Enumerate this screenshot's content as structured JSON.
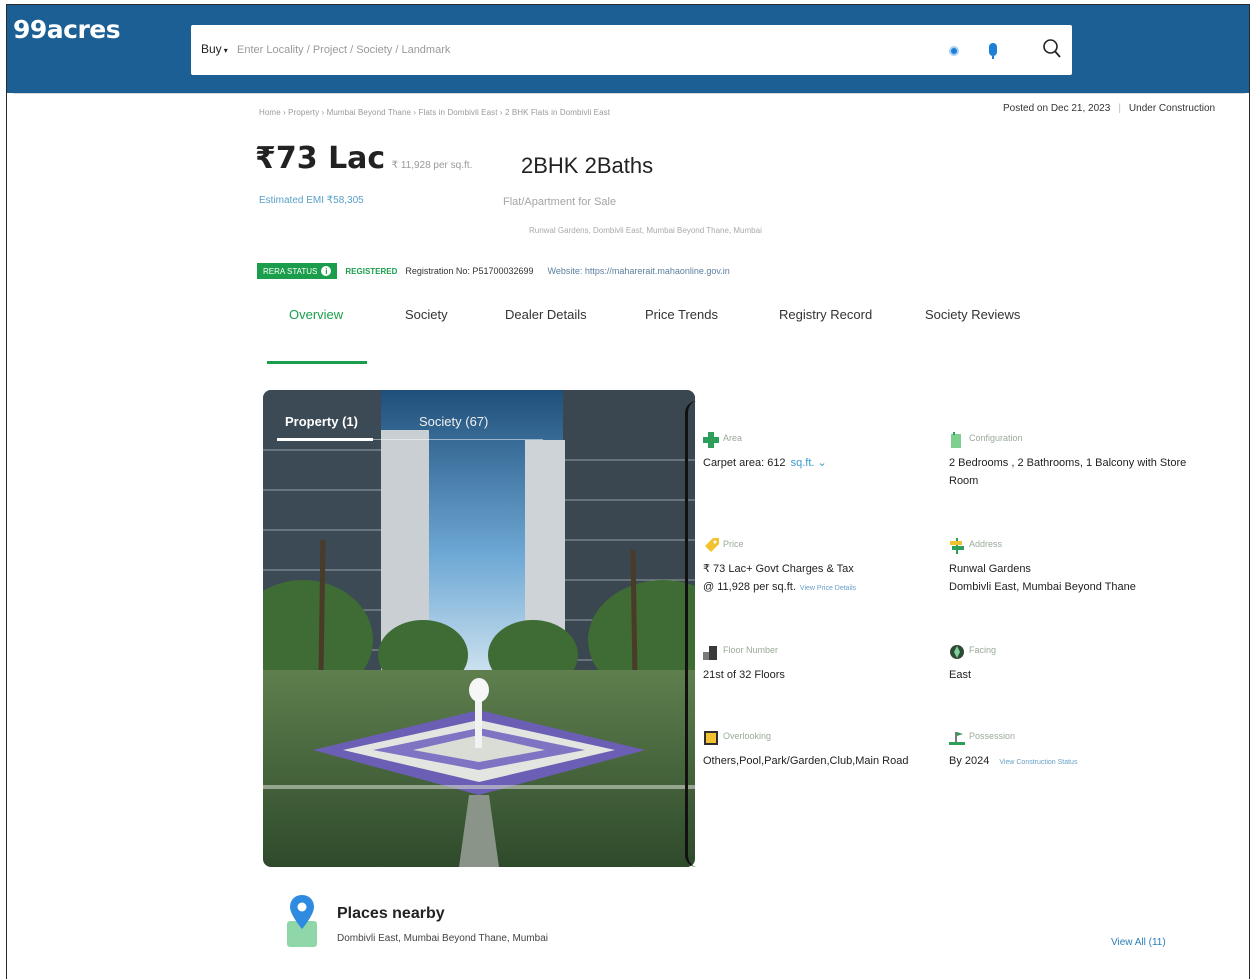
{
  "header": {
    "logo": "99acres",
    "buy_label": "Buy",
    "search_placeholder": "Enter Locality / Project / Society / Landmark"
  },
  "breadcrumb": "Home › Property › Mumbai Beyond Thane › Flats in Dombivli East › 2 BHK Flats in Dombivli East",
  "meta": {
    "posted": "Posted on Dec 21, 2023",
    "status": "Under Construction"
  },
  "listing": {
    "price": "₹73 Lac",
    "rate": "₹ 11,928 per sq.ft.",
    "emi": "Estimated EMI ₹58,305",
    "title": "2BHK 2Baths",
    "subtitle": "Flat/Apartment for Sale",
    "location": "Runwal Gardens, Dombivli East, Mumbai Beyond Thane, Mumbai"
  },
  "rera": {
    "badge": "RERA STATUS",
    "status": "REGISTERED",
    "registration": "Registration No: P51700032699",
    "website": "Website: https://maharerait.mahaonline.gov.in"
  },
  "tabs": [
    "Overview",
    "Society",
    "Dealer Details",
    "Price Trends",
    "Registry Record",
    "Society Reviews"
  ],
  "gallery": {
    "tab_property": "Property (1)",
    "tab_society": "Society (67)"
  },
  "details": {
    "area": {
      "label": "Area",
      "value": "Carpet area: 612",
      "unit": "sq.ft. ⌄"
    },
    "configuration": {
      "label": "Configuration",
      "value": "2 Bedrooms , 2 Bathrooms, 1 Balcony with Store Room"
    },
    "price": {
      "label": "Price",
      "value_line1": "₹ 73 Lac+ Govt Charges & Tax",
      "value_line2": "@ 11,928 per sq.ft.",
      "link": "View Price Details"
    },
    "address": {
      "label": "Address",
      "value_line1": "Runwal Gardens",
      "value_line2": "Dombivli East, Mumbai Beyond Thane"
    },
    "floor": {
      "label": "Floor Number",
      "value": "21st of 32 Floors"
    },
    "facing": {
      "label": "Facing",
      "value": "East"
    },
    "overlooking": {
      "label": "Overlooking",
      "value": "Others,Pool,Park/Garden,Club,Main Road"
    },
    "possession": {
      "label": "Possession",
      "value": "By 2024",
      "link": "View Construction Status"
    }
  },
  "places": {
    "title": "Places nearby",
    "subtitle": "Dombivli East, Mumbai Beyond Thane, Mumbai",
    "view_all": "View All (11)"
  },
  "colors": {
    "header_bg": "#1c5f94",
    "accent_green": "#1a9e4b",
    "link_blue": "#2a7fb8"
  }
}
